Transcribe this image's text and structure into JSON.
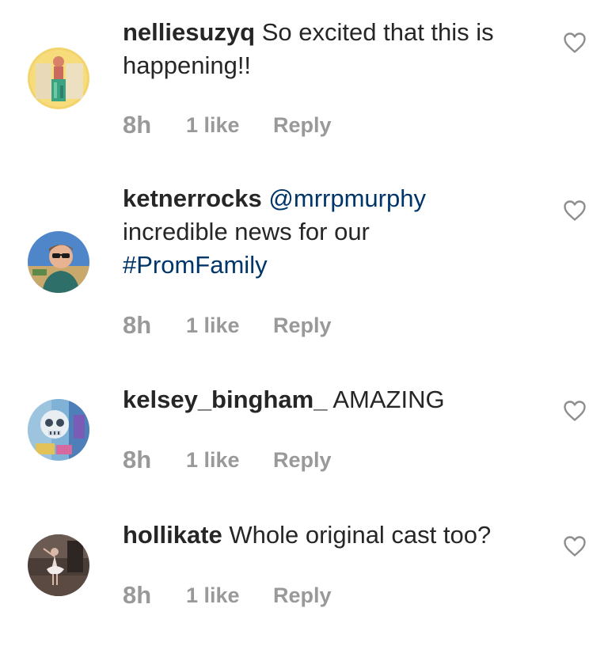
{
  "comments": [
    {
      "username": "nelliesuzyq",
      "text": "So excited that this is happening!!",
      "time": "8h",
      "likes": "1 like",
      "reply": "Reply",
      "avatar_icon": "avatar-woman-colorful-dress"
    },
    {
      "username": "ketnerrocks",
      "mention": "@mrrpmurphy",
      "text": "incredible news for our",
      "hashtag": "#PromFamily",
      "time": "8h",
      "likes": "1 like",
      "reply": "Reply",
      "avatar_icon": "avatar-man-sunglasses-sky"
    },
    {
      "username": "kelsey_bingham_",
      "text": "AMAZING",
      "time": "8h",
      "likes": "1 like",
      "reply": "Reply",
      "avatar_icon": "avatar-mural-artwork"
    },
    {
      "username": "hollikate",
      "text": "Whole original cast too?",
      "time": "8h",
      "likes": "1 like",
      "reply": "Reply",
      "avatar_icon": "avatar-dancer-dim-room"
    }
  ],
  "colors": {
    "text": "#262626",
    "meta": "#999999",
    "link": "#003569",
    "heart": "#8e8e8e"
  }
}
